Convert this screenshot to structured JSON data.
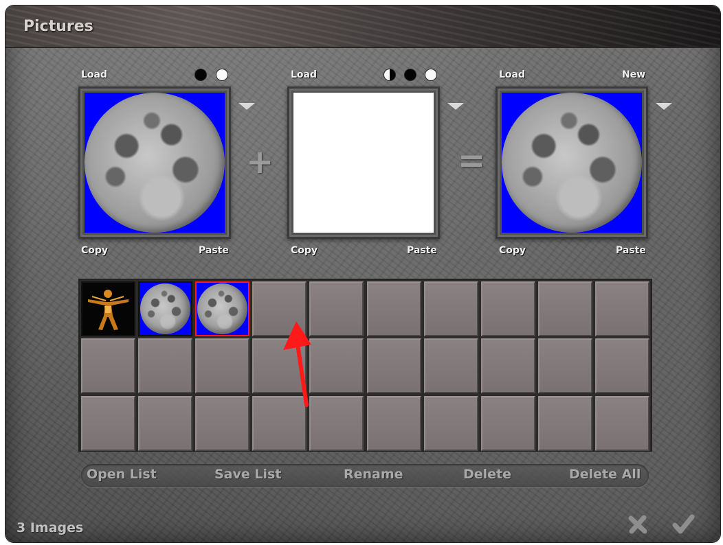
{
  "window": {
    "title": "Pictures"
  },
  "panels": [
    {
      "top_left": "Load",
      "top_right": "",
      "bottom_left": "Copy",
      "bottom_right": "Paste",
      "content": "moon",
      "mode_dots": [
        "black",
        "white"
      ]
    },
    {
      "top_left": "Load",
      "top_right": "",
      "bottom_left": "Copy",
      "bottom_right": "Paste",
      "content": "blank",
      "mode_dots": [
        "half",
        "black",
        "white"
      ]
    },
    {
      "top_left": "Load",
      "top_right": "New",
      "bottom_left": "Copy",
      "bottom_right": "Paste",
      "content": "moon",
      "mode_dots": []
    }
  ],
  "operators": {
    "plus": "+",
    "equals": "="
  },
  "icons": {
    "dropdown": "triangle-down-icon",
    "cancel": "x-icon",
    "confirm": "checkmark-icon"
  },
  "thumbnail_grid": {
    "rows": 3,
    "columns": 10,
    "items": [
      {
        "index": 0,
        "image": "vitruvian-figure",
        "selected": false
      },
      {
        "index": 1,
        "image": "moon",
        "selected": false
      },
      {
        "index": 2,
        "image": "moon",
        "selected": true
      }
    ]
  },
  "buttons": {
    "open_list": "Open List",
    "save_list": "Save List",
    "rename": "Rename",
    "delete": "Delete",
    "delete_all": "Delete All"
  },
  "status": {
    "count_label": "3 Images"
  },
  "colors": {
    "image_background": "#0000ff",
    "selection_border": "#ff1a1a",
    "annotation_arrow": "#ff1a1a"
  }
}
